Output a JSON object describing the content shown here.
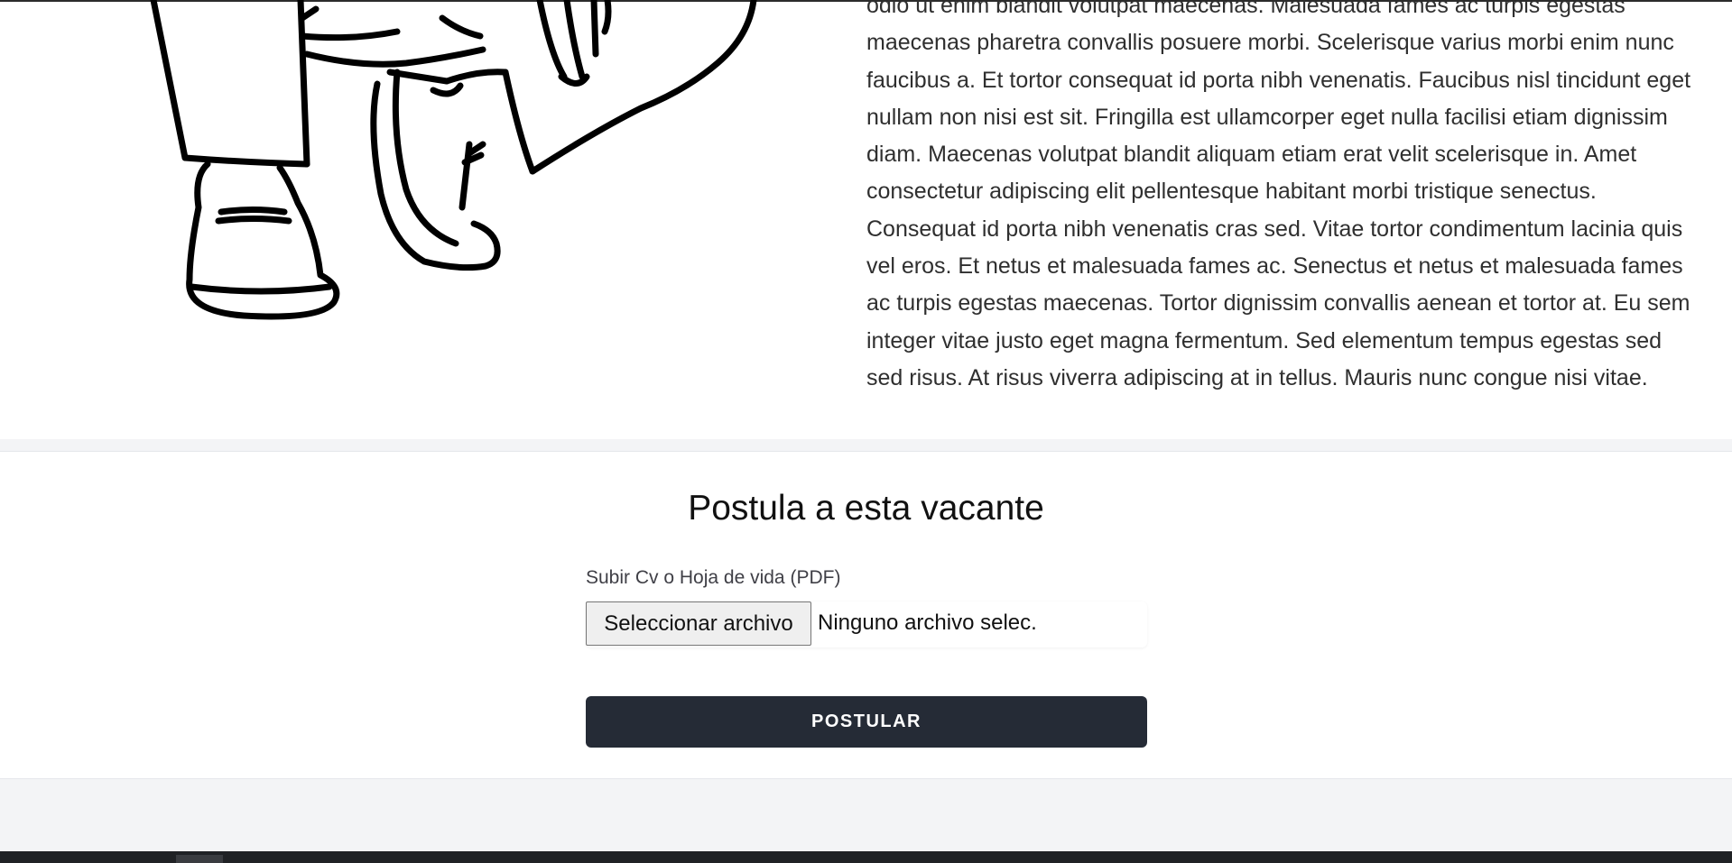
{
  "description": {
    "lines": [
      "odio ut enim blandit volutpat maecenas. Malesuada fames ac turpis egestas",
      "maecenas pharetra convallis posuere morbi. Scelerisque varius morbi enim nunc",
      "faucibus a. Et tortor consequat id porta nibh venenatis. Faucibus nisl tincidunt eget",
      "nullam non nisi est sit. Fringilla est ullamcorper eget nulla facilisi etiam dignissim",
      "diam. Maecenas volutpat blandit aliquam etiam erat velit scelerisque in. Amet",
      "consectetur adipiscing elit pellentesque habitant morbi tristique senectus.",
      "Consequat id porta nibh venenatis cras sed. Vitae tortor condimentum lacinia quis",
      "vel eros. Et netus et malesuada fames ac. Senectus et netus et malesuada fames",
      "ac turpis egestas maecenas. Tortor dignissim convallis aenean et tortor at. Eu sem",
      "integer vitae justo eget magna fermentum. Sed elementum tempus egestas sed",
      "sed risus. At risus viverra adipiscing at in tellus. Mauris nunc congue nisi vitae."
    ]
  },
  "form": {
    "title": "Postula a esta vacante",
    "file_label": "Subir Cv o Hoja de vida (PDF)",
    "file_button": "Seleccionar archivo",
    "file_status": "Ninguno archivo selec.",
    "submit_label": "POSTULAR"
  },
  "colors": {
    "submit_background": "#252b36",
    "page_background": "#f3f4f6"
  }
}
